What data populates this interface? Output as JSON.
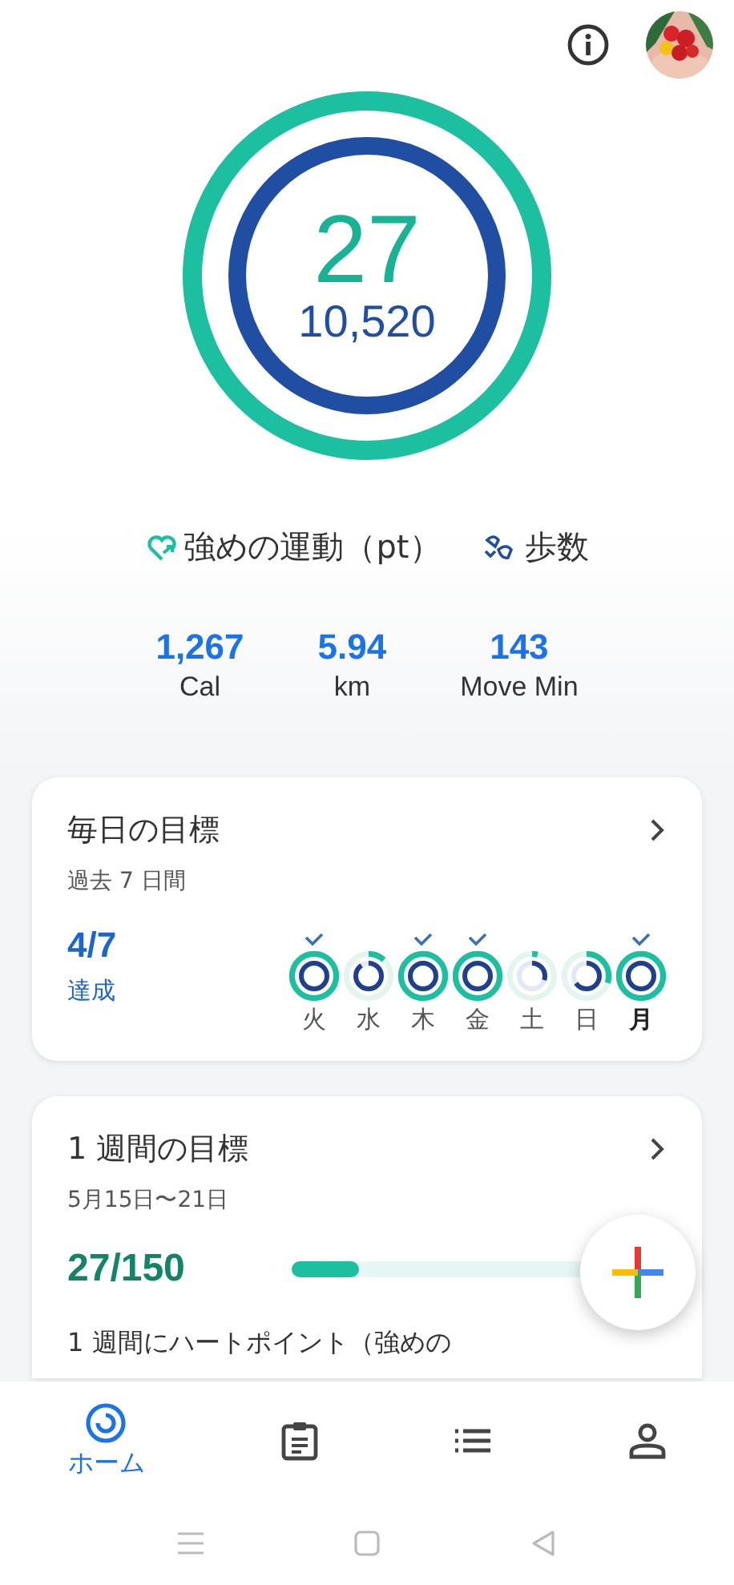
{
  "rings": {
    "heart_points": "27",
    "steps": "10,520",
    "progress": [
      {
        "level": 1
      },
      {
        "level": 1
      }
    ]
  },
  "legend": [
    {
      "kind": "heart",
      "label": "強めの運動（pt）"
    },
    {
      "kind": "steps",
      "label": "歩数"
    }
  ],
  "stats": [
    {
      "value": "1,267",
      "label": "Cal"
    },
    {
      "value": "5.94",
      "label": "km"
    },
    {
      "value": "143",
      "label": "Move Min"
    }
  ],
  "daily_goals": {
    "title": "毎日の目標",
    "subtitle": "過去 7 日間",
    "achieved": "4/7",
    "achieved_label": "達成",
    "days": [
      {
        "label": "火",
        "checked": true,
        "selected": false,
        "rings": [
          {
            "level": 1
          },
          {
            "level": 1
          }
        ]
      },
      {
        "label": "水",
        "checked": false,
        "selected": false,
        "rings": [
          {
            "level": 0.12
          },
          {
            "level": 0.9
          }
        ]
      },
      {
        "label": "木",
        "checked": true,
        "selected": false,
        "rings": [
          {
            "level": 1
          },
          {
            "level": 1
          }
        ]
      },
      {
        "label": "金",
        "checked": true,
        "selected": false,
        "rings": [
          {
            "level": 1
          },
          {
            "level": 1
          }
        ]
      },
      {
        "label": "土",
        "checked": false,
        "selected": false,
        "rings": [
          {
            "level": 0.04
          },
          {
            "level": 0.3
          }
        ]
      },
      {
        "label": "日",
        "checked": false,
        "selected": false,
        "rings": [
          {
            "level": 0.3
          },
          {
            "level": 0.65
          }
        ]
      },
      {
        "label": "月",
        "checked": true,
        "selected": true,
        "rings": [
          {
            "level": 1
          },
          {
            "level": 1
          }
        ]
      }
    ]
  },
  "weekly_goal": {
    "title": "1 週間の目標",
    "date_range": "5月15日〜21日",
    "progress": "27/150",
    "level": 0.18,
    "description": "1 週間にハートポイント（強めの"
  },
  "bottom_nav": [
    {
      "kind": "home",
      "label": "ホーム",
      "selected": true
    },
    {
      "kind": "journal",
      "selected": false
    },
    {
      "kind": "browse",
      "selected": false
    },
    {
      "kind": "profile",
      "selected": false
    }
  ]
}
